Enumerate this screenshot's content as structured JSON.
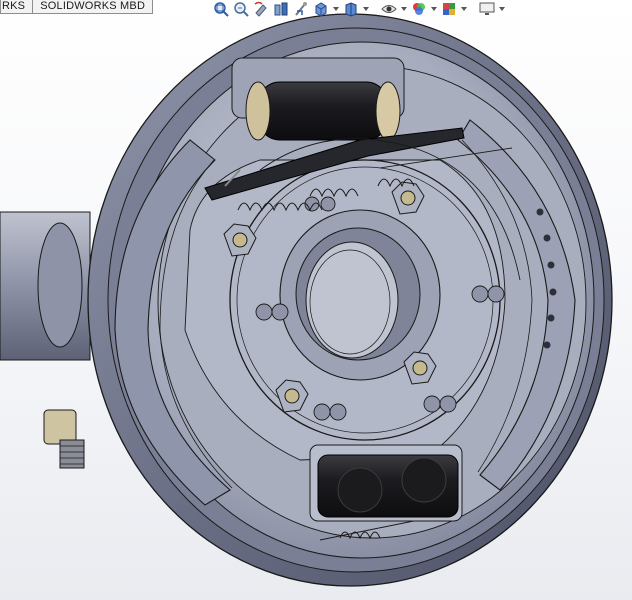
{
  "tabs": [
    {
      "label": "RKS",
      "partial": true
    },
    {
      "label": "SOLIDWORKS MBD",
      "partial": false
    }
  ],
  "heads_up_toolbar": {
    "buttons": [
      {
        "icon": "zoom-to-fit-icon"
      },
      {
        "icon": "zoom-to-area-icon"
      },
      {
        "icon": "previous-view-icon"
      },
      {
        "icon": "section-view-icon"
      },
      {
        "icon": "dynamic-annotation-views-icon"
      },
      {
        "icon": "view-orientation-icon",
        "dropdown": true
      },
      {
        "icon": "display-style-icon",
        "dropdown": true
      },
      {
        "icon": "hide-show-items-icon",
        "dropdown": true
      },
      {
        "icon": "edit-appearance-icon",
        "dropdown": true
      },
      {
        "icon": "apply-scene-icon",
        "dropdown": true
      },
      {
        "icon": "view-settings-icon",
        "dropdown": true
      }
    ]
  },
  "model": {
    "description_icon": "drum-brake-assembly-3d-model",
    "colors": {
      "metal_light": "#b7bccb",
      "metal_mid": "#8f95aa",
      "metal_dark": "#5f6478",
      "rubber": "#1f1f22",
      "edge": "#1a1a1a"
    }
  }
}
